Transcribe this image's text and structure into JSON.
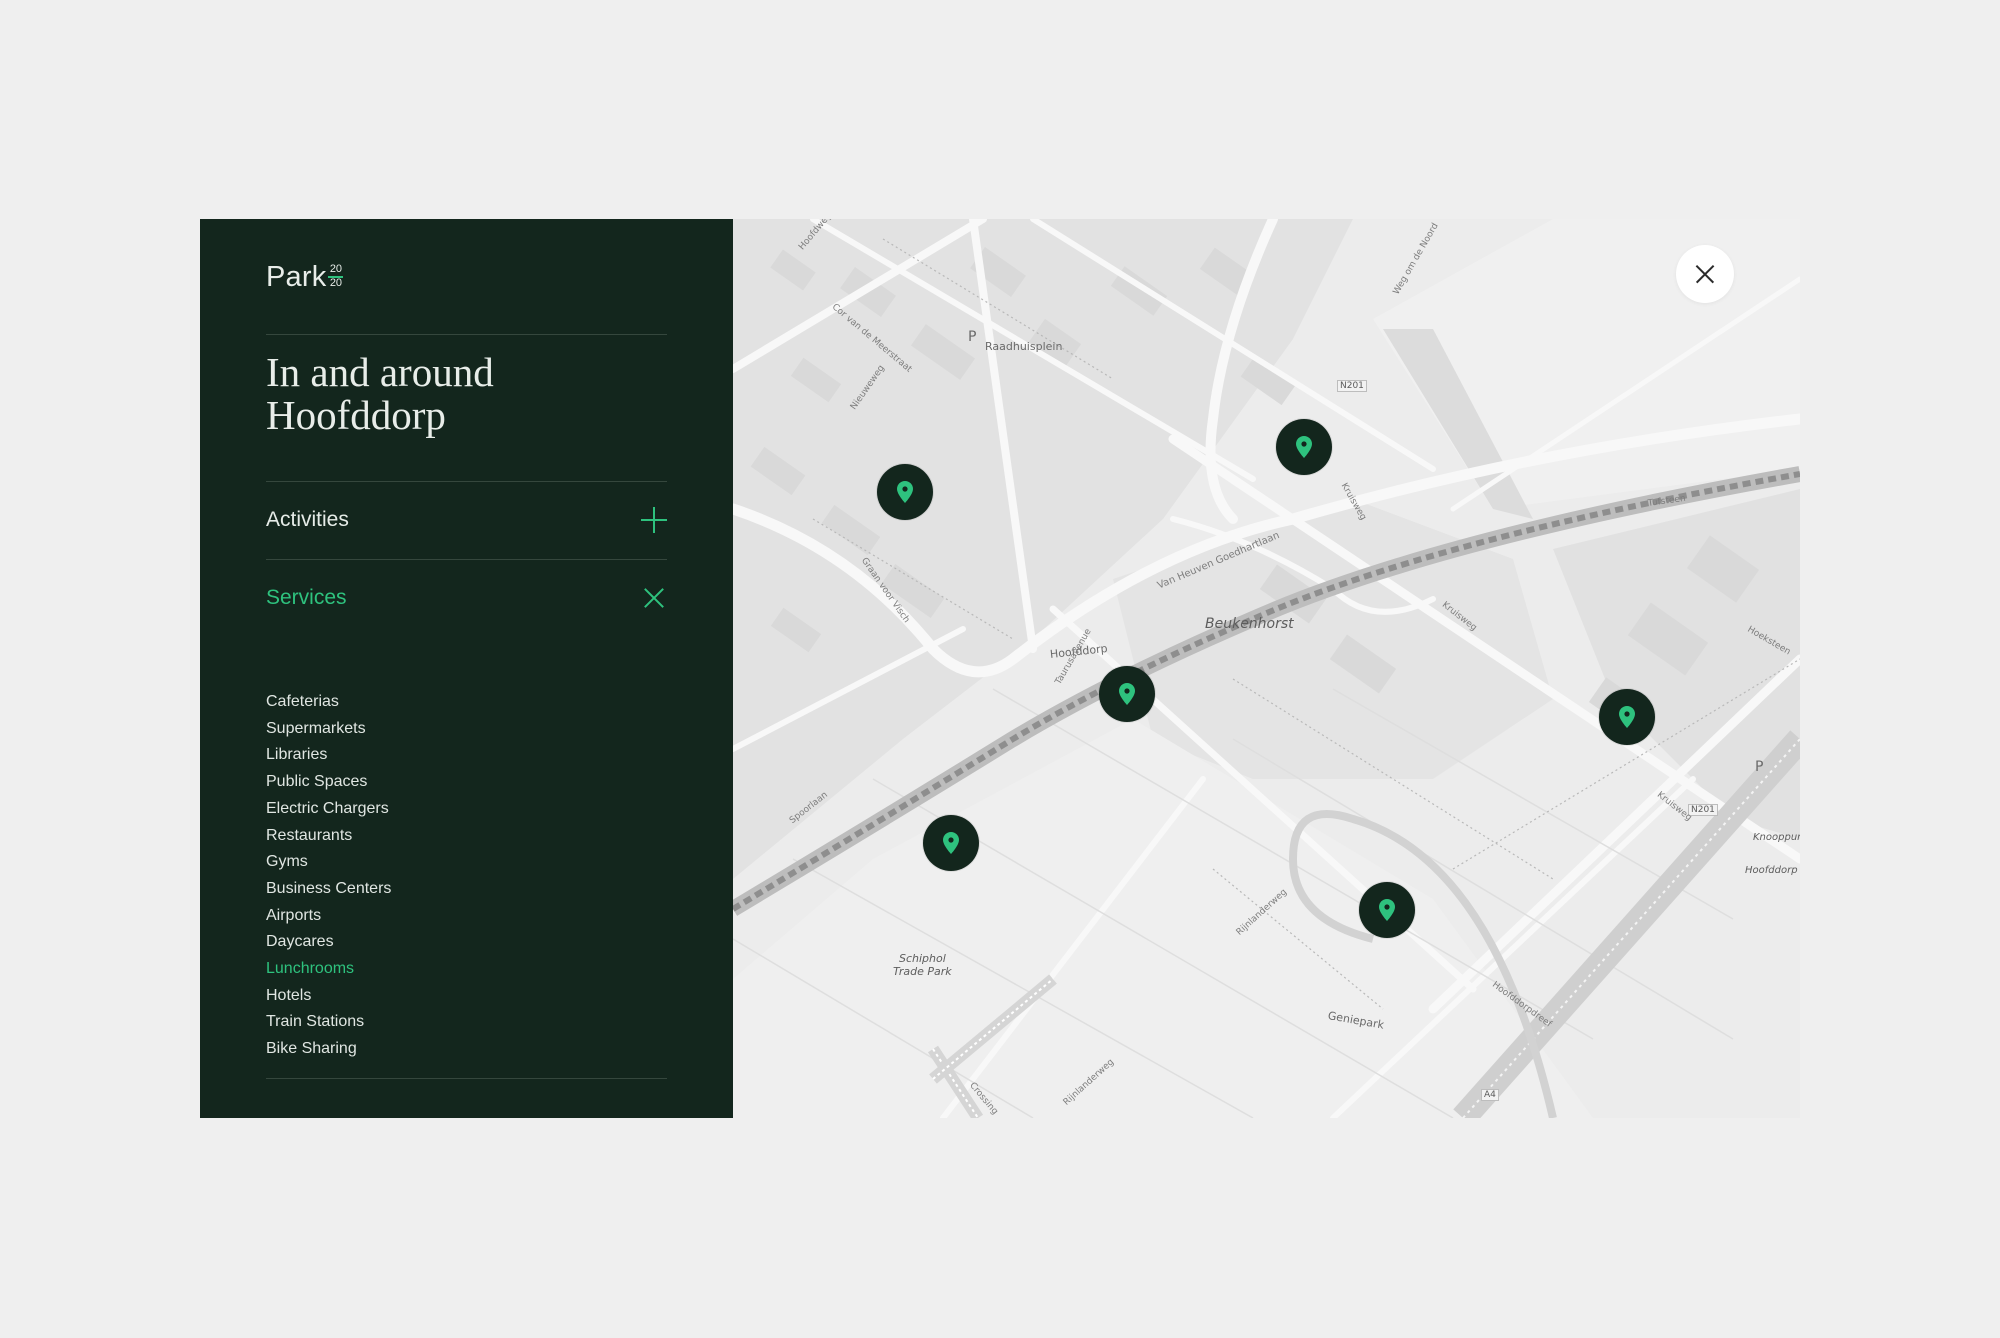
{
  "brand": {
    "name": "Park",
    "superscript_top": "20",
    "superscript_bottom": "20",
    "accent_color": "#2ec27e",
    "panel_color": "#13261d"
  },
  "panel": {
    "title_line1": "In and around",
    "title_line2": "Hoofddorp"
  },
  "accordion": [
    {
      "label": "Activities",
      "state": "collapsed",
      "icon": "plus-icon"
    },
    {
      "label": "Services",
      "state": "expanded",
      "icon": "close-icon"
    }
  ],
  "services": {
    "items": [
      "Cafeterias",
      "Supermarkets",
      "Libraries",
      "Public Spaces",
      "Electric Chargers",
      "Restaurants",
      "Gyms",
      "Business Centers",
      "Airports",
      "Daycares",
      "Lunchrooms",
      "Hotels",
      "Train Stations",
      "Bike Sharing"
    ],
    "selected": "Lunchrooms"
  },
  "map": {
    "close_icon": "close-icon",
    "pin_icon": "map-pin-icon",
    "pin_count": 6,
    "labels": {
      "area_beukenhorst": "Beukenhorst",
      "area_trade_park_1": "Schiphol",
      "area_trade_park_2": "Trade Park",
      "place_hoofddorp": "Hoofddorp",
      "place_raadhuisplein": "Raadhuisplein",
      "place_geniepark": "Geniepark",
      "place_knooppunt": "Knooppunt",
      "place_hoofddorp3": "Hoofddorp",
      "parking": "P",
      "road_n201_a": "N201",
      "road_n201_b": "N201",
      "road_a4": "A4",
      "street_van_heuven": "Van Heuven Goedhartlaan",
      "street_kruisweg_1": "Kruisweg",
      "street_kruisweg_2": "Kruisweg",
      "street_kruisweg_3": "Kruisweg",
      "street_weg_om_de_noord": "Weg om de Noord",
      "street_spoorlaan": "Spoorlaan",
      "street_hoofddorpdreef": "Hoofddorpdreef",
      "street_rijnlanderweg_1": "Rijnlanderweg",
      "street_rijnlanderweg_2": "Rijnlanderweg",
      "street_graan_voor_visch": "Graan voor Visch",
      "street_nieuweweg": "Nieuweweg",
      "street_taurusavenue": "Taurusavenue",
      "street_tufsteen": "Tufsteen",
      "street_hoeksteen": "Hoeksteen",
      "street_hoofdweg": "Hoofdweg",
      "street_cor_van_de_meerstraat": "Cor van de Meerstraat",
      "street_crossing": "Crossing"
    }
  }
}
